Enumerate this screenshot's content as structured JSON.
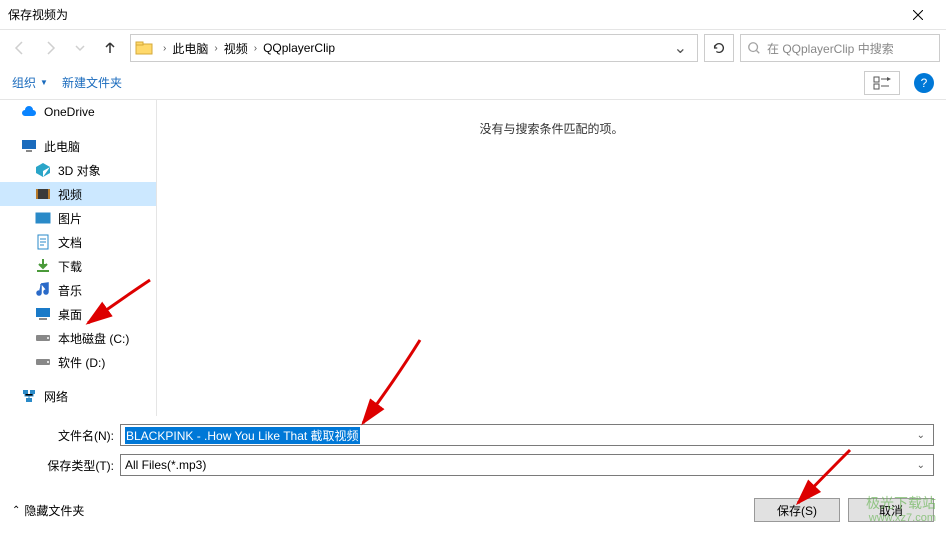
{
  "title": "保存视频为",
  "breadcrumb": {
    "root": "此电脑",
    "level1": "视频",
    "level2": "QQplayerClip"
  },
  "search": {
    "placeholder": "在 QQplayerClip 中搜索"
  },
  "toolbar": {
    "organize": "组织",
    "newfolder": "新建文件夹"
  },
  "sidebar": {
    "onedrive": "OneDrive",
    "thispc": "此电脑",
    "3d": "3D 对象",
    "video": "视频",
    "pictures": "图片",
    "documents": "文档",
    "downloads": "下载",
    "music": "音乐",
    "desktop": "桌面",
    "diskC": "本地磁盘 (C:)",
    "diskD": "软件 (D:)",
    "network": "网络"
  },
  "content": {
    "empty": "没有与搜索条件匹配的项。"
  },
  "fields": {
    "filenameLabel": "文件名(N):",
    "filenameValue": "BLACKPINK - .How You Like That 截取视频",
    "savetypeLabel": "保存类型(T):",
    "savetypeValue": "All Files(*.mp3)"
  },
  "footer": {
    "hidefolders": "隐藏文件夹",
    "save": "保存(S)",
    "cancel": "取消"
  },
  "watermark": {
    "cn": "极光下载站",
    "en": "www.xz7.com"
  }
}
